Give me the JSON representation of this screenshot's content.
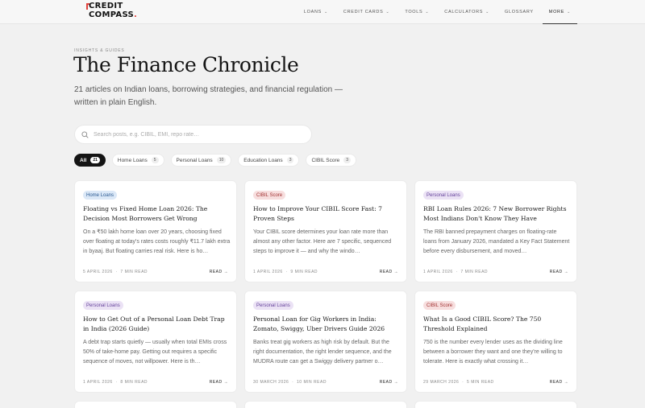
{
  "brand": {
    "line1": "CREDIT",
    "line2": "COMPASS",
    "dot": "."
  },
  "nav": [
    {
      "label": "LOANS",
      "chevron": true,
      "active": false
    },
    {
      "label": "CREDIT CARDS",
      "chevron": true,
      "active": false
    },
    {
      "label": "TOOLS",
      "chevron": true,
      "active": false
    },
    {
      "label": "CALCULATORS",
      "chevron": true,
      "active": false
    },
    {
      "label": "GLOSSARY",
      "chevron": false,
      "active": false
    },
    {
      "label": "MORE",
      "chevron": true,
      "active": true
    }
  ],
  "hero": {
    "eyebrow": "INSIGHTS & GUIDES",
    "title": "The Finance Chronicle",
    "subtitle": "21 articles on Indian loans, borrowing strategies, and financial regulation — written in plain English."
  },
  "search": {
    "placeholder": "Search posts, e.g. CIBIL, EMI, repo rate…"
  },
  "filters": [
    {
      "label": "All",
      "count": "21",
      "active": true
    },
    {
      "label": "Home Loans",
      "count": "5",
      "active": false
    },
    {
      "label": "Personal Loans",
      "count": "10",
      "active": false
    },
    {
      "label": "Education Loans",
      "count": "3",
      "active": false
    },
    {
      "label": "CIBIL Score",
      "count": "3",
      "active": false
    }
  ],
  "cards": [
    {
      "tag": "Home Loans",
      "tag_type": "home",
      "title": "Floating vs Fixed Home Loan 2026: The Decision Most Borrowers Get Wrong",
      "excerpt": "On a ₹50 lakh home loan over 20 years, choosing fixed over floating at today's rates costs roughly ₹11.7 lakh extra in byaaj. But floating carries real risk. Here is ho…",
      "date": "5 APRIL 2026",
      "read_time": "7 MIN READ",
      "read_label": "READ →"
    },
    {
      "tag": "CIBIL Score",
      "tag_type": "cibil",
      "title": "How to Improve Your CIBIL Score Fast: 7 Proven Steps",
      "excerpt": "Your CIBIL score determines your loan rate more than almost any other factor. Here are 7 specific, sequenced steps to improve it — and why the windo…",
      "date": "1 APRIL 2026",
      "read_time": "9 MIN READ",
      "read_label": "READ →"
    },
    {
      "tag": "Personal Loans",
      "tag_type": "personal",
      "title": "RBI Loan Rules 2026: 7 New Borrower Rights Most Indians Don't Know They Have",
      "excerpt": "The RBI banned prepayment charges on floating-rate loans from January 2026, mandated a Key Fact Statement before every disbursement, and moved…",
      "date": "1 APRIL 2026",
      "read_time": "7 MIN READ",
      "read_label": "READ →"
    },
    {
      "tag": "Personal Loans",
      "tag_type": "personal",
      "title": "How to Get Out of a Personal Loan Debt Trap in India (2026 Guide)",
      "excerpt": "A debt trap starts quietly — usually when total EMIs cross 50% of take-home pay. Getting out requires a specific sequence of moves, not willpower. Here is th…",
      "date": "1 APRIL 2026",
      "read_time": "8 MIN READ",
      "read_label": "READ →"
    },
    {
      "tag": "Personal Loans",
      "tag_type": "personal",
      "title": "Personal Loan for Gig Workers in India: Zomato, Swiggy, Uber Drivers Guide 2026",
      "excerpt": "Banks treat gig workers as high risk by default. But the right documentation, the right lender sequence, and the MUDRA route can get a Swiggy delivery partner o…",
      "date": "30 MARCH 2026",
      "read_time": "10 MIN READ",
      "read_label": "READ →"
    },
    {
      "tag": "CIBIL Score",
      "tag_type": "cibil",
      "title": "What Is a Good CIBIL Score? The 750 Threshold Explained",
      "excerpt": "750 is the number every lender uses as the dividing line between a borrower they want and one they're willing to tolerate. Here is exactly what crossing it…",
      "date": "29 MARCH 2026",
      "read_time": "5 MIN READ",
      "read_label": "READ →"
    }
  ]
}
